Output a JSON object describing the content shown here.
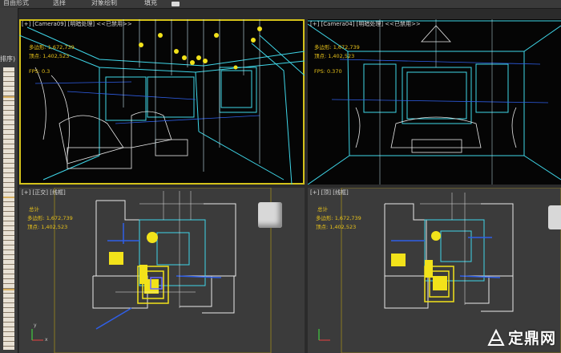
{
  "menubar": {
    "items": [
      "自由形式",
      "选择",
      "对象绘制",
      "填充"
    ]
  },
  "left_strip": {
    "label": "排序)"
  },
  "viewports": [
    {
      "label": "[+] [Camera09] [明暗处理] <<已禁用>>",
      "stats": [
        {
          "name": "多边形:",
          "value": "1,672,739"
        },
        {
          "name": "顶点:",
          "value": "1,402,523"
        },
        {
          "name": "FPS:",
          "value": "0.3"
        }
      ]
    },
    {
      "label": "[+] [Camera04] [明暗处理] <<已禁用>>",
      "stats": [
        {
          "name": "多边形:",
          "value": "1,672,739"
        },
        {
          "name": "顶点:",
          "value": "1,402,523"
        },
        {
          "name": "FPS:",
          "value": "0.370"
        }
      ]
    },
    {
      "label": "[+] [正交] [线框]",
      "stats": [
        {
          "name": "",
          "value": "总计"
        },
        {
          "name": "多边形:",
          "value": "1,672,739"
        },
        {
          "name": "顶点:",
          "value": "1,402,523"
        }
      ]
    },
    {
      "label": "[+] [顶] [线框]",
      "stats": [
        {
          "name": "",
          "value": "总计"
        },
        {
          "name": "多边形:",
          "value": "1,672,739"
        },
        {
          "name": "顶点:",
          "value": "1,402,523"
        }
      ]
    }
  ],
  "axis_labels": {
    "x": "x",
    "y": "y"
  },
  "watermark": {
    "text": "定鼎网"
  },
  "colors": {
    "active_border": "#d4c21a",
    "stat_text": "#e8c21a",
    "wire_cyan": "#3fd6e8",
    "wire_blue": "#2f5fe8",
    "wire_yellow": "#f2e21a",
    "wire_white": "#e8e8e8"
  },
  "icons": [
    "3d-viewcube-icon",
    "axis-gizmo-icon",
    "logo-icon",
    "viewport-menu-icon"
  ]
}
